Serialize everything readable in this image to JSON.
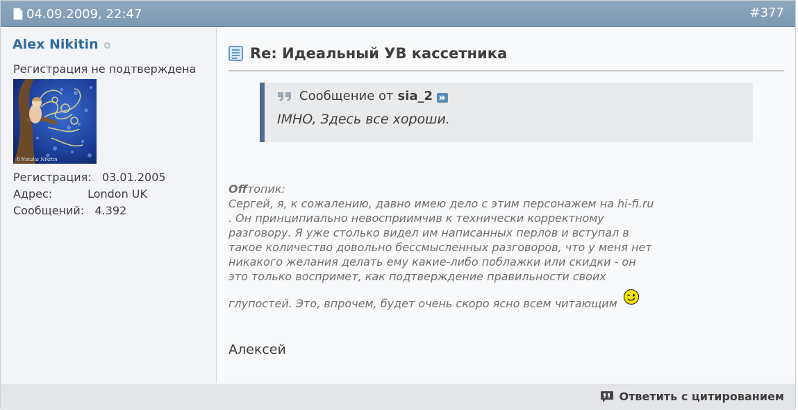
{
  "post": {
    "date": "04.09.2009, 22:47",
    "number": "#377",
    "title": "Re: Идеальный УВ кассетника",
    "signature": "Алексей"
  },
  "user": {
    "name": "Alex Nikitin",
    "status": "offline",
    "title": "Регистрация не подтверждена",
    "stats": [
      {
        "label": "Регистрация:",
        "value": "03.01.2005"
      },
      {
        "label": "Адрес:",
        "value": "London UK"
      },
      {
        "label": "Сообщений:",
        "value": "4.392"
      }
    ],
    "avatar_caption": "© Natalia Nikitin"
  },
  "quote": {
    "prefix": "Сообщение от",
    "author": "sia_2",
    "text": "IMHO, Здесь все хороши."
  },
  "offtopic": {
    "label_bold": "Off",
    "label_rest": "топик:",
    "lines": [
      "Сергей, я, к сожалению, давно имею дело с этим персонажем на hi-fi.ru",
      ". Он принципиально невосприимчив к технически корректному",
      "разговору. Я уже столько видел им написанных перлов и вступал в",
      "такое количество довольно бессмысленных разговоров, что у меня нет",
      "никакого желания делать ему какие-либо поблажки или скидки - он",
      "это только воспримет, как подтверждение правильности своих",
      "глупостей. Это, впрочем, будет очень скоро ясно всем читающим"
    ]
  },
  "footer": {
    "reply_quote_label": "Ответить с цитированием"
  },
  "colors": {
    "header_bg": "#819eb7",
    "username": "#2f6b9b",
    "quote_border": "#4f6e8f",
    "sidebar_bg": "#f2f4f7",
    "content_bg": "#f8f9fa",
    "footer_bg": "#e3e5e8"
  },
  "icons": {
    "post_date": "document-icon",
    "title": "post-document-icon",
    "quote": "quote-marks-icon",
    "quote_jump": "jump-to-post-icon",
    "smiley": "wink-smiley-icon",
    "reply": "quote-bubble-icon"
  }
}
